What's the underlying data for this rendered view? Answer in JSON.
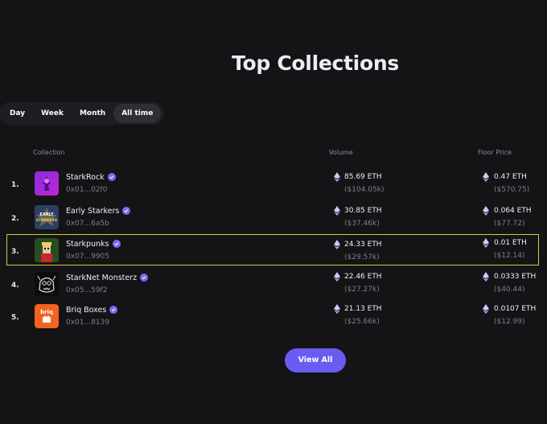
{
  "page": {
    "title": "Top Collections"
  },
  "tabs": [
    {
      "label": "Day",
      "active": false
    },
    {
      "label": "Week",
      "active": false
    },
    {
      "label": "Month",
      "active": false
    },
    {
      "label": "All time",
      "active": true
    }
  ],
  "table": {
    "headers": {
      "collection": "Collection",
      "volume": "Volume",
      "floor": "Floor Price"
    },
    "rows": [
      {
        "rank": "1.",
        "name": "StarkRock",
        "address": "0x01...02f0",
        "volume_eth": "85.69 ETH",
        "volume_usd": "($104.05k)",
        "floor_eth": "0.47 ETH",
        "floor_usd": "($570.75)",
        "verified": true,
        "avatar_icon": "starkrock-avatar-icon"
      },
      {
        "rank": "2.",
        "name": "Early Starkers",
        "address": "0x07...6a5b",
        "volume_eth": "30.85 ETH",
        "volume_usd": "($37.46k)",
        "floor_eth": "0.064 ETH",
        "floor_usd": "($77.72)",
        "verified": true,
        "avatar_icon": "early-starkers-avatar-icon",
        "avatar_text": [
          "EARLY",
          "STARKERS"
        ]
      },
      {
        "rank": "3.",
        "name": "Starkpunks",
        "address": "0x07...9905",
        "volume_eth": "24.33 ETH",
        "volume_usd": "($29.57k)",
        "floor_eth": "0.01 ETH",
        "floor_usd": "($12.14)",
        "verified": true,
        "selected": true,
        "avatar_icon": "starkpunks-avatar-icon"
      },
      {
        "rank": "4.",
        "name": "StarkNet Monsterz",
        "address": "0x05...59f2",
        "volume_eth": "22.46 ETH",
        "volume_usd": "($27.27k)",
        "floor_eth": "0.0333 ETH",
        "floor_usd": "($40.44)",
        "verified": true,
        "avatar_icon": "monsterz-avatar-icon"
      },
      {
        "rank": "5.",
        "name": "Briq Boxes",
        "address": "0x01...8139",
        "volume_eth": "21.13 ETH",
        "volume_usd": "($25.66k)",
        "floor_eth": "0.0107 ETH",
        "floor_usd": "($12.99)",
        "verified": true,
        "avatar_icon": "briq-avatar-icon",
        "avatar_text": [
          "briq"
        ]
      }
    ]
  },
  "actions": {
    "view_all_label": "View All"
  },
  "colors": {
    "accent": "#6a5cf0",
    "verified": "#7b6cf0",
    "selection": "#d4c93a",
    "background": "#141417"
  },
  "icons": {
    "verified": "verified-check-icon",
    "currency": "ethereum-icon"
  }
}
